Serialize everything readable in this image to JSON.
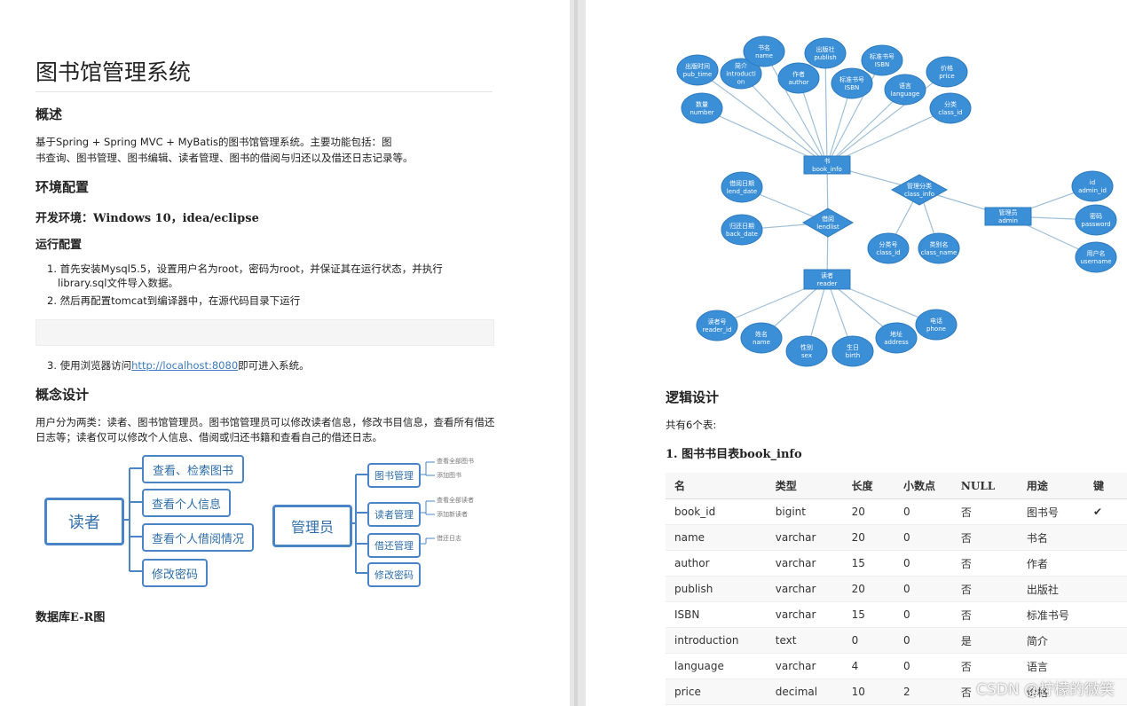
{
  "doc_title": "图书馆管理系统",
  "overview": {
    "heading": "概述",
    "line1": "基于Spring + Spring MVC + MyBatis的图书馆管理系统。主要功能包括：图",
    "line2": "书查询、图书管理、图书编辑、读者管理、图书的借阅与归还以及借还日志记录等。"
  },
  "env": {
    "heading": "环境配置",
    "dev_env": "开发环境：Windows 10，idea/eclipse",
    "run_heading": "运行配置",
    "steps": [
      {
        "num": "1.",
        "text_a": "首先安装Mysql5.5，设置用户名为root，密码为root，并保证其在运行状态，并执行",
        "text_b": "library.sql文件导入数据。"
      },
      {
        "num": "2.",
        "text_a": "然后再配置tomcat到编译器中，在源代码目录下运行"
      },
      {
        "num": "3.",
        "text_pre": "使用浏览器访问",
        "link": "http://localhost:8080",
        "text_post": "即可进入系统。"
      }
    ]
  },
  "concept": {
    "heading": "概念设计",
    "line1": "用户分为两类：读者、图书馆管理员。图书馆管理员可以修改读者信息，修改书目信息，查看所有借还",
    "line2": "日志等；读者仅可以修改个人信息、借阅或归还书籍和查看自己的借还日志。"
  },
  "mindmap": {
    "reader": "读者",
    "reader_items": [
      "查看、检索图书",
      "查看个人信息",
      "查看个人借阅情况",
      "修改密码"
    ],
    "admin": "管理员",
    "admin_items": [
      "图书管理",
      "读者管理",
      "借还管理",
      "修改密码"
    ],
    "admin_sub": [
      "查看全部图书",
      "添加图书",
      "查看全部读者",
      "添加新读者",
      "借还日志"
    ]
  },
  "er_label": "数据库E-R图",
  "er": {
    "book": {
      "name": "书",
      "en": "book_info"
    },
    "book_attrs": [
      {
        "cn": "出版时间",
        "en": "pub_time"
      },
      {
        "cn": "简介",
        "en": "introducti",
        "en2": "on"
      },
      {
        "cn": "书名",
        "en": "name"
      },
      {
        "cn": "作者",
        "en": "author"
      },
      {
        "cn": "出版社",
        "en": "publish"
      },
      {
        "cn": "标准书号",
        "en": "ISBN"
      },
      {
        "cn": "标准书号",
        "en": "ISBN"
      },
      {
        "cn": "语言",
        "en": "language"
      },
      {
        "cn": "价格",
        "en": "price"
      },
      {
        "cn": "分类",
        "en": "class_id"
      },
      {
        "cn": "数量",
        "en": "number"
      }
    ],
    "lend": {
      "cn": "借阅",
      "en": "lendlist"
    },
    "lend_attrs": [
      {
        "cn": "借阅日期",
        "en": "lend_date"
      },
      {
        "cn": "归还日期",
        "en": "back_date"
      }
    ],
    "class": {
      "cn": "管理分类",
      "en": "class_info"
    },
    "class_attrs": [
      {
        "cn": "分类号",
        "en": "class_id"
      },
      {
        "cn": "类别名",
        "en": "class_name"
      }
    ],
    "admin": {
      "cn": "管理员",
      "en": "admin"
    },
    "admin_attrs": [
      {
        "cn": "id",
        "en": "admin_id"
      },
      {
        "cn": "密码",
        "en": "password"
      },
      {
        "cn": "用户名",
        "en": "username"
      }
    ],
    "reader": {
      "cn": "读者",
      "en": "reader"
    },
    "reader_attrs": [
      {
        "cn": "读者号",
        "en": "reader_id"
      },
      {
        "cn": "姓名",
        "en": "name"
      },
      {
        "cn": "性别",
        "en": "sex"
      },
      {
        "cn": "生日",
        "en": "birth"
      },
      {
        "cn": "地址",
        "en": "address"
      },
      {
        "cn": "电话",
        "en": "phone"
      }
    ]
  },
  "logic": {
    "heading": "逻辑设计",
    "count": "共有6个表:",
    "table1_title": "1. 图书书目表book_info",
    "columns": [
      "名",
      "类型",
      "长度",
      "小数点",
      "NULL",
      "用途",
      "键"
    ],
    "rows": [
      [
        "book_id",
        "bigint",
        "20",
        "0",
        "否",
        "图书号",
        "✔"
      ],
      [
        "name",
        "varchar",
        "20",
        "0",
        "否",
        "书名",
        ""
      ],
      [
        "author",
        "varchar",
        "15",
        "0",
        "否",
        "作者",
        ""
      ],
      [
        "publish",
        "varchar",
        "20",
        "0",
        "否",
        "出版社",
        ""
      ],
      [
        "ISBN",
        "varchar",
        "15",
        "0",
        "否",
        "标准书号",
        ""
      ],
      [
        "introduction",
        "text",
        "0",
        "0",
        "是",
        "简介",
        ""
      ],
      [
        "language",
        "varchar",
        "4",
        "0",
        "否",
        "语言",
        ""
      ],
      [
        "price",
        "decimal",
        "10",
        "2",
        "否",
        "价格",
        ""
      ]
    ]
  },
  "watermark": "CSDN @柠檬的微笑",
  "colors": {
    "er_fill": "#3a8fd6",
    "er_stroke": "#2f7bbf",
    "mindmap": "#4a86c7",
    "link": "#3b7bbf"
  }
}
